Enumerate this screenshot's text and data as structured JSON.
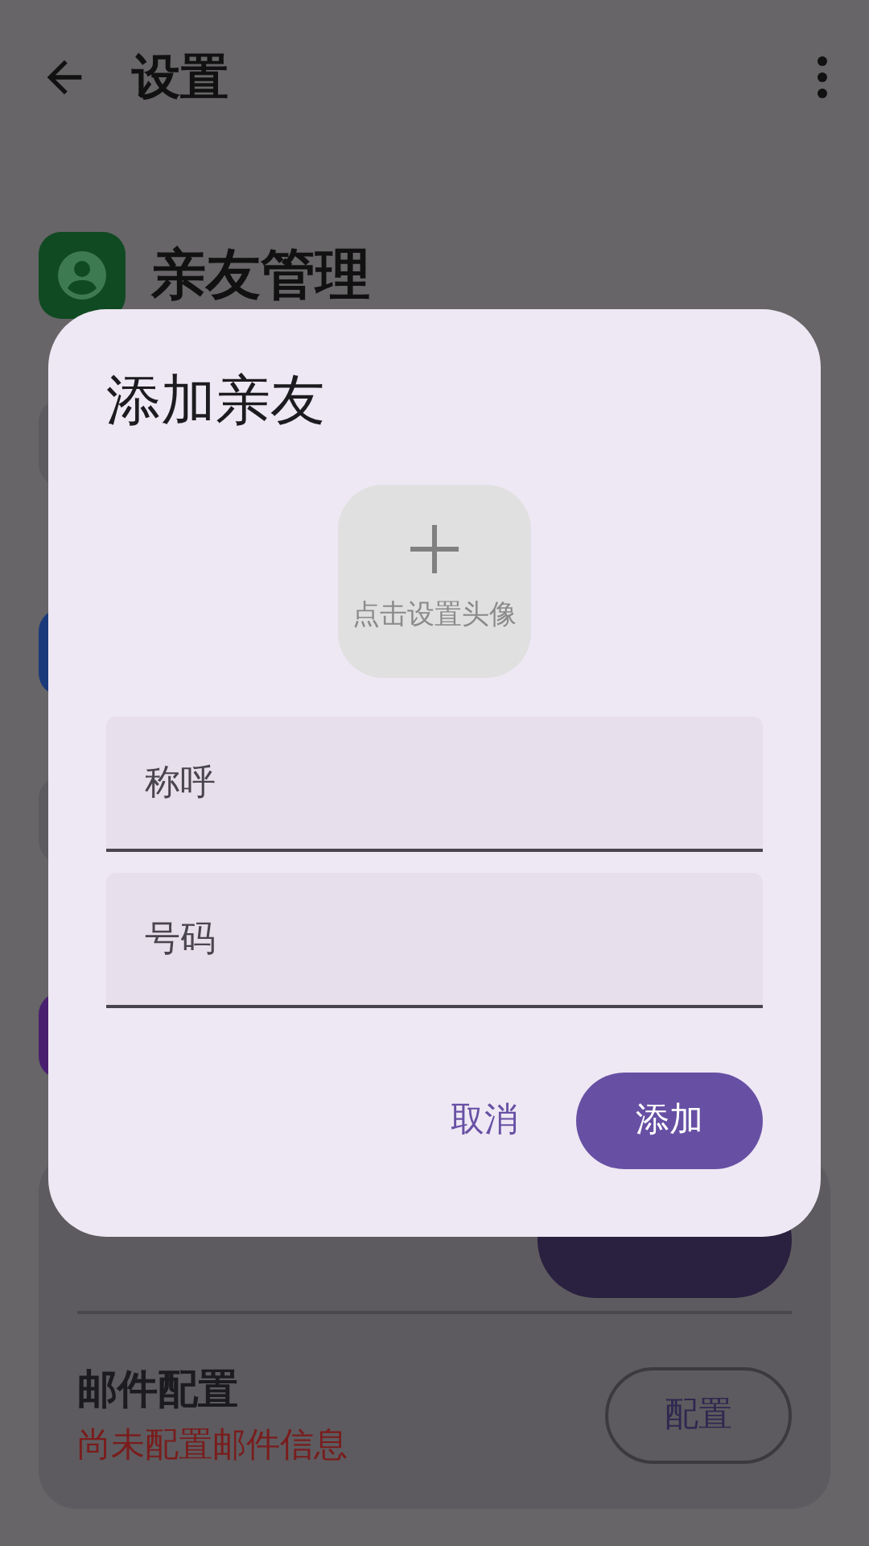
{
  "app_bar": {
    "title": "设置"
  },
  "section": {
    "title": "亲友管理"
  },
  "email_card": {
    "rows": [
      {
        "kind": "notify"
      },
      {
        "kind": "config",
        "title": "邮件配置",
        "subtitle": "尚未配置邮件信息",
        "button": "配置"
      }
    ]
  },
  "dialog": {
    "title": "添加亲友",
    "avatar_hint": "点击设置头像",
    "fields": [
      {
        "placeholder": "称呼"
      },
      {
        "placeholder": "号码"
      }
    ],
    "buttons": [
      {
        "kind": "text",
        "label": "取消"
      },
      {
        "kind": "filled",
        "label": "添加"
      }
    ]
  }
}
